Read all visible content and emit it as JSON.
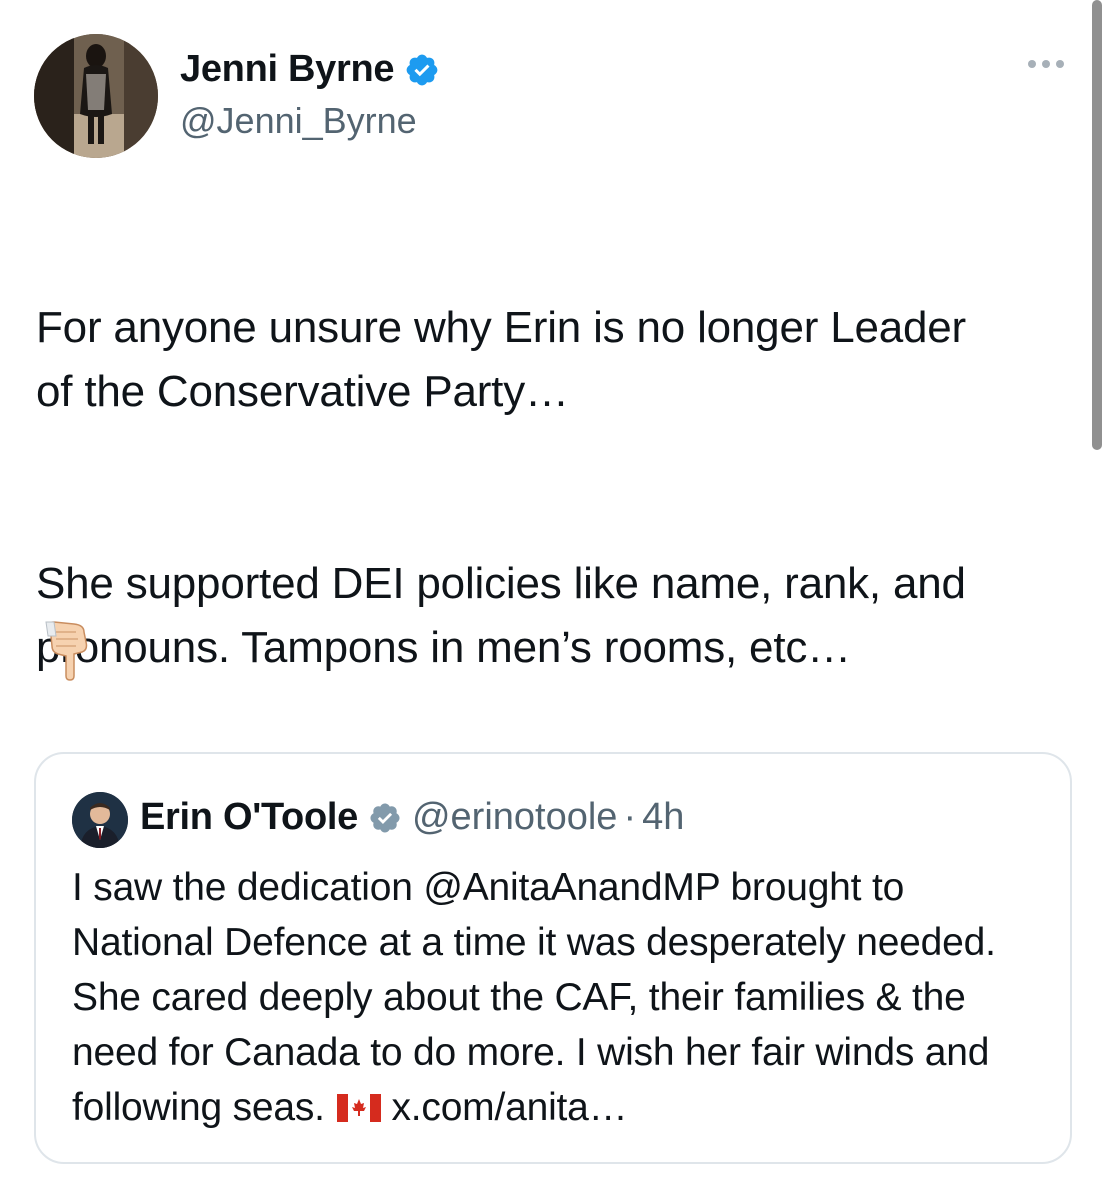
{
  "author": {
    "display_name": "Jenni Byrne",
    "handle": "@Jenni_Byrne",
    "verified": true
  },
  "tweet": {
    "paragraph_1": "For anyone unsure why Erin is no longer Leader\nof the Conservative Party…",
    "paragraph_2": "She supported DEI policies like name, rank, and\npronouns. Tampons in men’s rooms, etc…",
    "emoji": "backhand-index-pointing-down-icon"
  },
  "quoted_tweet": {
    "display_name": "Erin O'Toole",
    "handle": "@erinotoole",
    "separator": "·",
    "time": "4h",
    "verified": true,
    "text_main": "I saw the dedication @AnitaAnandMP brought to National Defence at a time it was desperately needed. She cared deeply about the CAF, their families & the need for Canada to do more. I wish her fair winds and following seas.",
    "flag_icon": "canada-flag-icon",
    "link": "x.com/anita…"
  },
  "colors": {
    "text": "#0f1419",
    "secondary_text": "#536471",
    "verified_blue": "#1d9bf0",
    "verified_grey": "#829aab",
    "border": "#dfe5ea"
  }
}
